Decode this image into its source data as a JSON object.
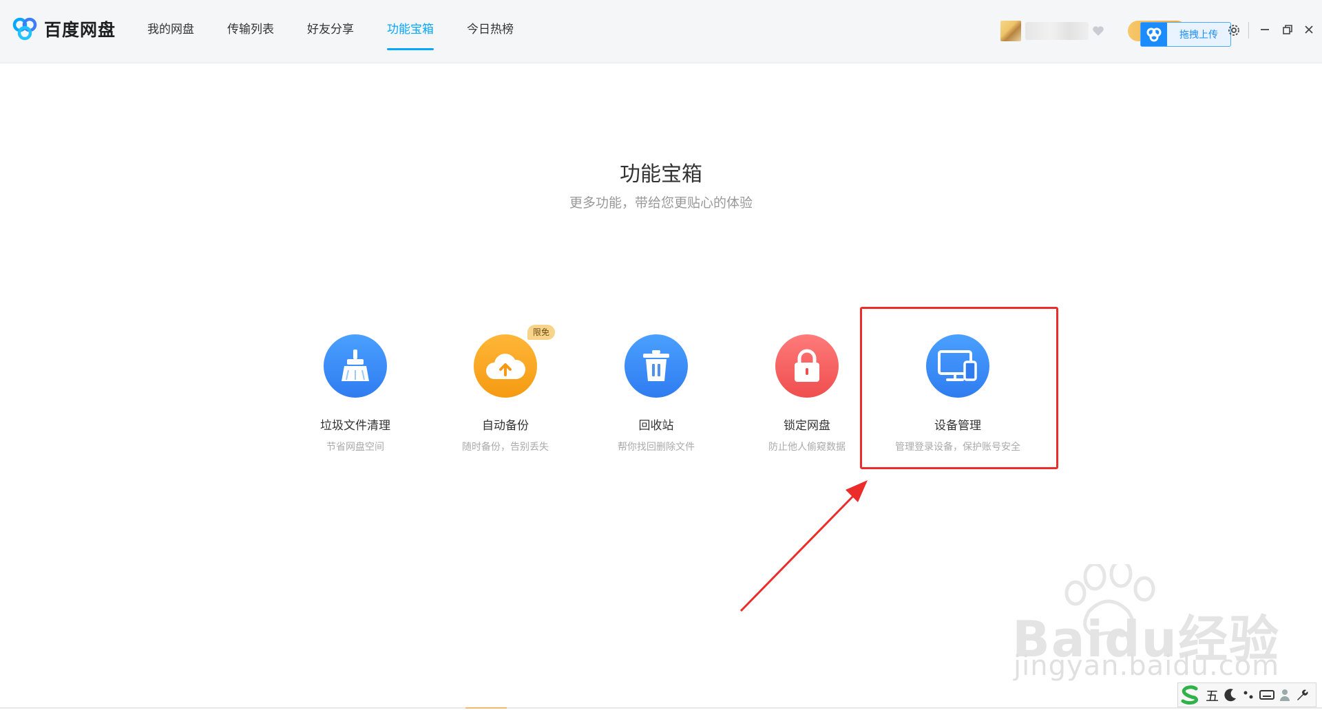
{
  "app": {
    "title": "百度网盘"
  },
  "nav": {
    "items": [
      {
        "label": "我的网盘",
        "active": false
      },
      {
        "label": "传输列表",
        "active": false
      },
      {
        "label": "好友分享",
        "active": false
      },
      {
        "label": "功能宝箱",
        "active": true
      },
      {
        "label": "今日热榜",
        "active": false
      }
    ]
  },
  "header": {
    "upload_label": "拖拽上传"
  },
  "main": {
    "title": "功能宝箱",
    "subtitle": "更多功能，带给您更贴心的体验",
    "tools": [
      {
        "name": "垃圾文件清理",
        "desc": "节省网盘空间",
        "icon": "broom-icon",
        "color": "#3a8ef6"
      },
      {
        "name": "自动备份",
        "desc": "随时备份，告别丢失",
        "icon": "cloud-upload-icon",
        "color": "#f7a51c",
        "badge": "限免"
      },
      {
        "name": "回收站",
        "desc": "帮你找回删除文件",
        "icon": "trash-icon",
        "color": "#3a8ef6"
      },
      {
        "name": "锁定网盘",
        "desc": "防止他人偷窥数据",
        "icon": "lock-icon",
        "color": "#f25c5c"
      },
      {
        "name": "设备管理",
        "desc": "管理登录设备，保护账号安全",
        "icon": "device-icon",
        "color": "#3a8ef6"
      }
    ]
  },
  "watermark": {
    "brand": "Baidu经验",
    "url": "jingyan.baidu.com"
  },
  "ime": {
    "mode": "五"
  },
  "colors": {
    "accent": "#06a7ff",
    "highlight": "#ec2b2b"
  }
}
